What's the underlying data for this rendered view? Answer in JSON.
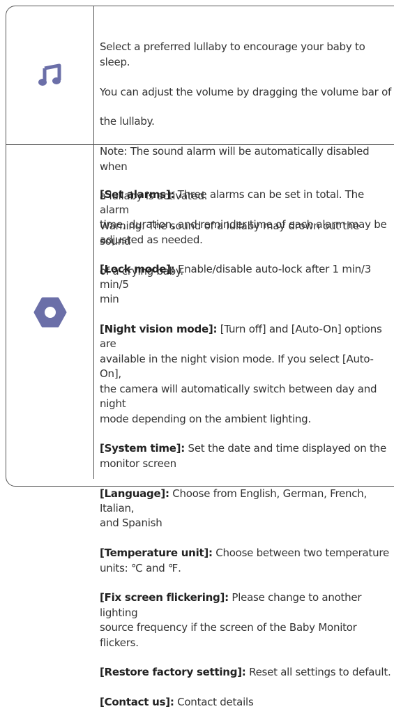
{
  "colors": {
    "icon": "#6b6fa8",
    "border": "#555555",
    "text": "#333333"
  },
  "rows": [
    {
      "icon": "music-note-icon",
      "lines": [
        "Select a preferred lullaby to encourage your baby to sleep.",
        "You can adjust the volume by dragging the volume bar of",
        "the lullaby.",
        "Note: The sound alarm will be automatically disabled when",
        "a lullaby is activated.",
        "Warning: The sound of a lullaby may drown out the sound",
        "of a crying baby."
      ]
    },
    {
      "icon": "settings-hexagon-icon",
      "items": [
        {
          "term": "[Set alarms]:",
          "text": " Three alarms can be set in total. The alarm\ntime, duration, and reminder time of each alarm may be\nadjusted as needed."
        },
        {
          "term": "[Lock mode]:",
          "text": " Enable/disable auto-lock after 1 min/3 min/5\nmin"
        },
        {
          "term": "[Night vision mode]:",
          "text": " [Turn off] and [Auto-On] options are\navailable in the night vision mode. If you select [Auto-On],\nthe camera will automatically switch between day and night\nmode depending on the ambient lighting."
        },
        {
          "term": "[System time]:",
          "text": " Set the date and time displayed on the\nmonitor screen"
        },
        {
          "term": "[Language]:",
          "text": " Choose from English, German, French, Italian,\nand Spanish"
        },
        {
          "term": "[Temperature unit]:",
          "text": " Choose between two temperature\nunits: ℃ and ℉."
        },
        {
          "term": "[Fix screen flickering]:",
          "text": " Please change to another lighting\nsource frequency if the screen of the Baby Monitor flickers."
        },
        {
          "term": "[Restore factory setting]:",
          "text": " Reset all settings to default."
        },
        {
          "term": "[Contact us]:",
          "text": " Contact details"
        }
      ]
    }
  ]
}
